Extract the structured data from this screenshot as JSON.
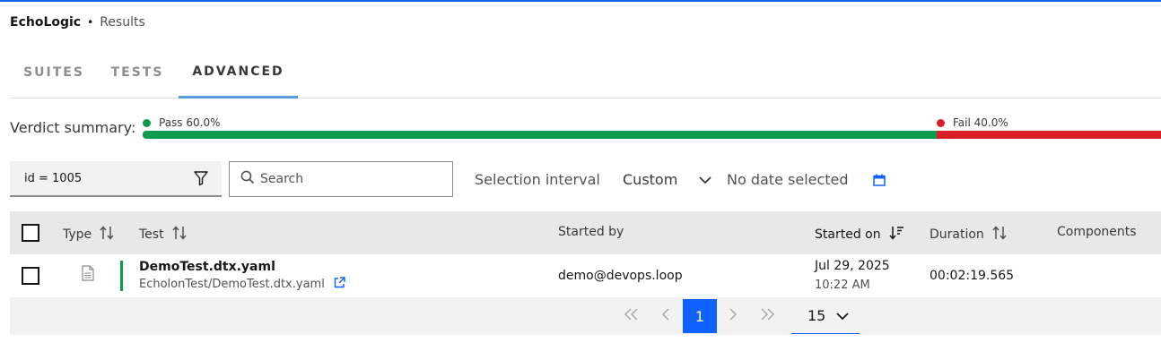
{
  "header": {
    "app_name": "EchoLogic",
    "separator": "•",
    "page": "Results"
  },
  "tabs": [
    {
      "label": "SUITES",
      "active": false
    },
    {
      "label": "TESTS",
      "active": false
    },
    {
      "label": "ADVANCED",
      "active": true
    }
  ],
  "verdict": {
    "label": "Verdict summary:",
    "pass": {
      "label": "Pass 60.0%",
      "fraction": 0.6,
      "color": "#0c9a4c"
    },
    "fail": {
      "label": "Fail 40.0%",
      "fraction": 0.4,
      "color": "#da1e28"
    }
  },
  "filters": {
    "query_value": "id = 1005",
    "search_placeholder": "Search",
    "interval_label": "Selection interval",
    "interval_value": "Custom",
    "date_value": "No date selected"
  },
  "table": {
    "columns": {
      "type": "Type",
      "test": "Test",
      "started_by": "Started by",
      "started_on": "Started on",
      "duration": "Duration",
      "components": "Components"
    },
    "rows": [
      {
        "name": "DemoTest.dtx.yaml",
        "path": "EcholonTest/DemoTest.dtx.yaml",
        "started_by": "demo@devops.loop",
        "date": "Jul 29, 2025",
        "time": "10:22 AM",
        "duration": "00:02:19.565",
        "status": "pass"
      }
    ]
  },
  "pagination": {
    "current_page": "1",
    "page_size": "15"
  },
  "colors": {
    "accent": "#0f62fe",
    "pass": "#0c9a4c",
    "fail": "#da1e28"
  }
}
